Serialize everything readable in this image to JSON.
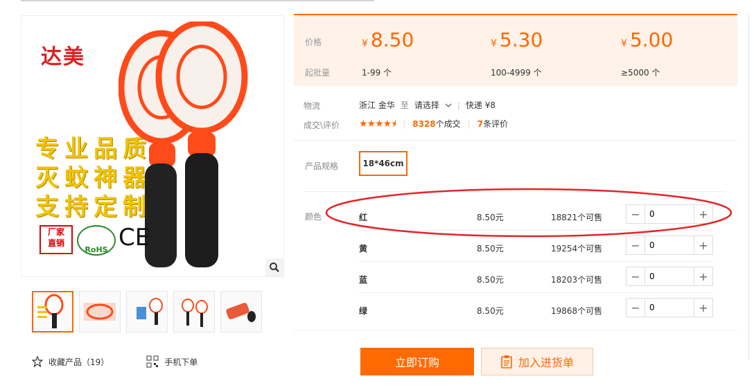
{
  "product": {
    "brand_text": "达美",
    "slogan_lines": [
      "专业品质",
      "灭蚊神器",
      "支持定制"
    ],
    "cert_marks": {
      "factory_line1": "厂家",
      "factory_line2": "直销",
      "rohs": "RoHS",
      "ce": "CE"
    }
  },
  "gallery": {
    "thumb_count": 5
  },
  "left_actions": {
    "favorite_label": "收藏产品（19）",
    "mobile_label": "手机下单"
  },
  "price": {
    "price_label": "价格",
    "moq_label": "起批量",
    "currency": "¥",
    "tiers": [
      {
        "price": "8.50",
        "range": "1-99 个"
      },
      {
        "price": "5.30",
        "range": "100-4999 个"
      },
      {
        "price": "5.00",
        "range": "≥5000 个"
      }
    ]
  },
  "logistics": {
    "label": "物流",
    "from": "浙江 金华",
    "to_word": "至",
    "select_placeholder": "请选择",
    "express": "快递 ¥8"
  },
  "trade": {
    "label": "成交\\评价",
    "rating": 4.5,
    "deals_count": "8328",
    "deals_suffix": "个成交",
    "reviews_count": "7",
    "reviews_suffix": "条评价"
  },
  "spec": {
    "label": "产品规格",
    "selected": "18*46cm"
  },
  "color": {
    "label": "颜色",
    "items": [
      {
        "name": "红",
        "price": "8.50元",
        "stock": "18821个可售",
        "qty": "0"
      },
      {
        "name": "黄",
        "price": "8.50元",
        "stock": "19254个可售",
        "qty": "0"
      },
      {
        "name": "蓝",
        "price": "8.50元",
        "stock": "18203个可售",
        "qty": "0"
      },
      {
        "name": "绿",
        "price": "8.50元",
        "stock": "19868个可售",
        "qty": "0"
      }
    ]
  },
  "actions": {
    "buy_now": "立即订购",
    "add_to_cart": "加入进货单"
  },
  "colors": {
    "accent": "#ff6a00",
    "price_bg": "#fff2e8",
    "highlight_ring": "#e0262a"
  }
}
